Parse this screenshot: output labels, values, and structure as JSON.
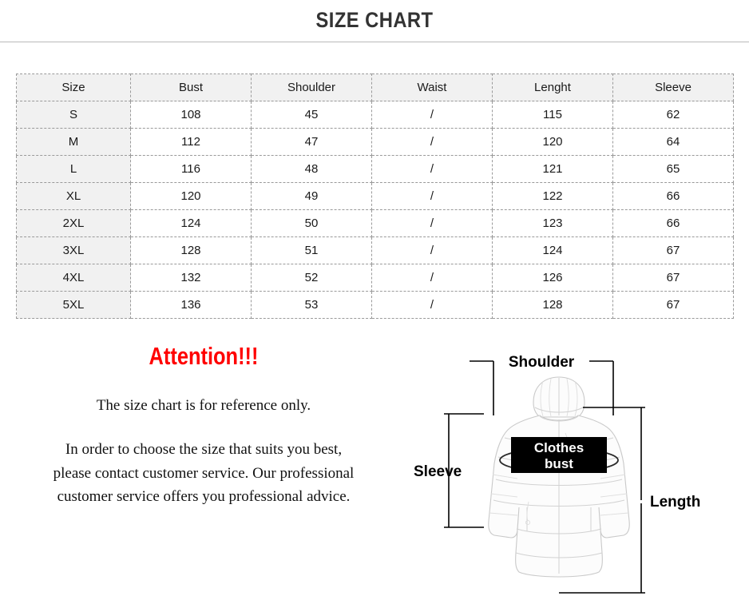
{
  "header": {
    "title": "SIZE CHART"
  },
  "table": {
    "columns": [
      "Size",
      "Bust",
      "Shoulder",
      "Waist",
      "Lenght",
      "Sleeve"
    ],
    "rows": [
      {
        "size": "S",
        "bust": "108",
        "shoulder": "45",
        "waist": "/",
        "lenght": "115",
        "sleeve": "62"
      },
      {
        "size": "M",
        "bust": "112",
        "shoulder": "47",
        "waist": "/",
        "lenght": "120",
        "sleeve": "64"
      },
      {
        "size": "L",
        "bust": "116",
        "shoulder": "48",
        "waist": "/",
        "lenght": "121",
        "sleeve": "65"
      },
      {
        "size": "XL",
        "bust": "120",
        "shoulder": "49",
        "waist": "/",
        "lenght": "122",
        "sleeve": "66"
      },
      {
        "size": "2XL",
        "bust": "124",
        "shoulder": "50",
        "waist": "/",
        "lenght": "123",
        "sleeve": "66"
      },
      {
        "size": "3XL",
        "bust": "128",
        "shoulder": "51",
        "waist": "/",
        "lenght": "124",
        "sleeve": "67"
      },
      {
        "size": "4XL",
        "bust": "132",
        "shoulder": "52",
        "waist": "/",
        "lenght": "126",
        "sleeve": "67"
      },
      {
        "size": "5XL",
        "bust": "136",
        "shoulder": "53",
        "waist": "/",
        "lenght": "128",
        "sleeve": "67"
      }
    ]
  },
  "attention": {
    "heading": "Attention!!!",
    "note_primary": "The size chart is for reference only.",
    "note_secondary_lines": [
      "In order to choose the size that suits you best,",
      "please contact customer service. Our professional",
      "customer service offers you professional advice."
    ]
  },
  "diagram": {
    "labels": {
      "shoulder": "Shoulder",
      "sleeve": "Sleeve",
      "length": "Length",
      "bust_line1": "Clothes",
      "bust_line2": "bust"
    }
  },
  "colors": {
    "title_text": "#333333",
    "attention_red": "#ff0000",
    "table_header_bg": "#f1f1f1",
    "table_border": "#9a9a9a",
    "rule": "#b9b9b9",
    "bust_badge_bg": "#000000"
  }
}
